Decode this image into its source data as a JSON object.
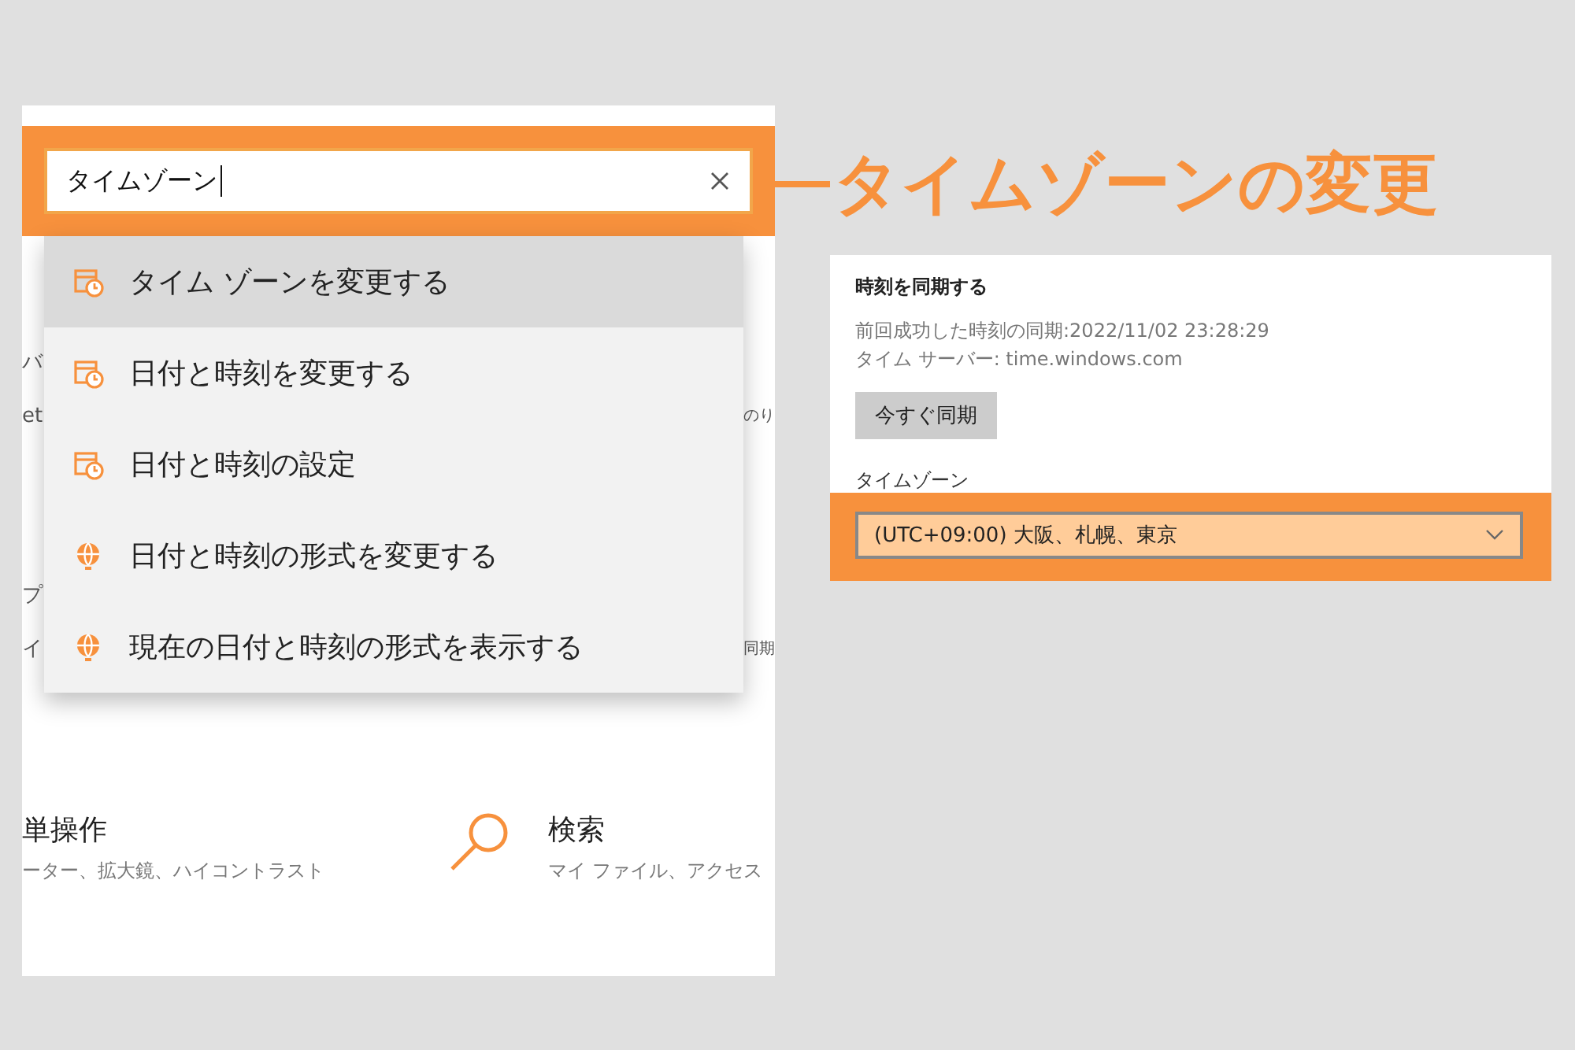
{
  "search": {
    "value": "タイムゾーン"
  },
  "suggestions": [
    {
      "label": "タイム ゾーンを変更する",
      "kind": "calendar",
      "selected": true
    },
    {
      "label": "日付と時刻を変更する",
      "kind": "calendar",
      "selected": false
    },
    {
      "label": "日付と時刻の設定",
      "kind": "calendar",
      "selected": false
    },
    {
      "label": "日付と時刻の形式を変更する",
      "kind": "globe",
      "selected": false
    },
    {
      "label": "現在の日付と時刻の形式を表示する",
      "kind": "globe",
      "selected": false
    }
  ],
  "background_fragments": [
    {
      "left": "バ"
    },
    {
      "left": "et",
      "right": "のり"
    },
    {
      "left": "プ"
    },
    {
      "left": "イ",
      "right": "同期"
    }
  ],
  "tiles": [
    {
      "title": "単操作",
      "subtitle": "ーター、拡大鏡、ハイコントラスト"
    },
    {
      "title": "検索",
      "subtitle": "マイ ファイル、アクセス",
      "kind": "search"
    }
  ],
  "heading": "タイムゾーンの変更",
  "sync": {
    "title": "時刻を同期する",
    "last_sync": "前回成功した時刻の同期:2022/11/02 23:28:29",
    "server": "タイム サーバー: time.windows.com",
    "button": "今すぐ同期"
  },
  "timezone": {
    "label": "タイムゾーン",
    "value": "(UTC+09:00) 大阪、札幌、東京"
  }
}
